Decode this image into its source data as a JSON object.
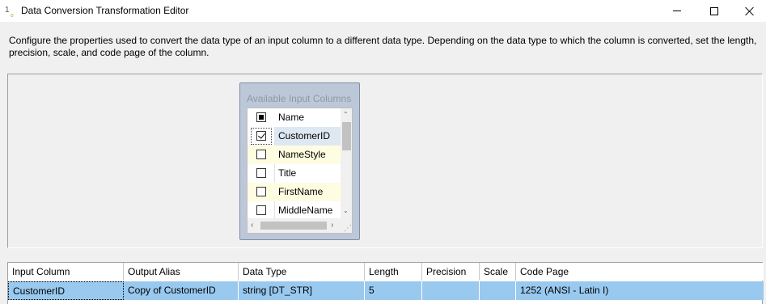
{
  "window": {
    "title": "Data Conversion Transformation Editor",
    "icon": "data-conversion-icon"
  },
  "description": "Configure the properties used to convert the data type of an input column to a different data type. Depending on the data type to which the column is converted, set the length, precision, scale, and code page of the column.",
  "available_columns": {
    "title": "Available Input Columns",
    "header": "Name",
    "items": [
      {
        "label": "CustomerID",
        "checked": true
      },
      {
        "label": "NameStyle",
        "checked": false
      },
      {
        "label": "Title",
        "checked": false
      },
      {
        "label": "FirstName",
        "checked": false
      },
      {
        "label": "MiddleName",
        "checked": false
      }
    ]
  },
  "grid": {
    "headers": [
      "Input Column",
      "Output Alias",
      "Data Type",
      "Length",
      "Precision",
      "Scale",
      "Code Page"
    ],
    "rows": [
      [
        "CustomerID",
        "Copy of CustomerID",
        "string [DT_STR]",
        "5",
        "",
        "",
        "1252  (ANSI - Latin I)"
      ]
    ]
  },
  "colors": {
    "selected_row": "#99c9ef",
    "alt_row": "#fffde1",
    "panel_border": "#7f8ea8"
  }
}
